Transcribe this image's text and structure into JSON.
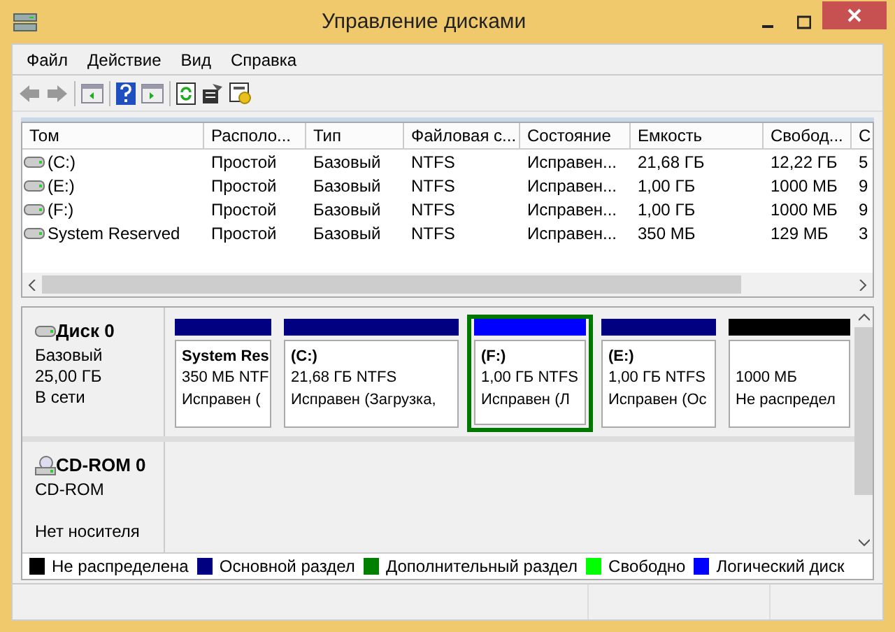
{
  "window": {
    "title": "Управление дисками"
  },
  "menu": [
    "Файл",
    "Действие",
    "Вид",
    "Справка"
  ],
  "table": {
    "columns": [
      "Том",
      "Располо...",
      "Тип",
      "Файловая с...",
      "Состояние",
      "Емкость",
      "Свобод...",
      "С"
    ],
    "rows": [
      [
        "(C:)",
        "Простой",
        "Базовый",
        "NTFS",
        "Исправен...",
        "21,68 ГБ",
        "12,22 ГБ",
        "5"
      ],
      [
        "(E:)",
        "Простой",
        "Базовый",
        "NTFS",
        "Исправен...",
        "1,00 ГБ",
        "1000 МБ",
        "9"
      ],
      [
        "(F:)",
        "Простой",
        "Базовый",
        "NTFS",
        "Исправен...",
        "1,00 ГБ",
        "1000 МБ",
        "9"
      ],
      [
        "System Reserved",
        "Простой",
        "Базовый",
        "NTFS",
        "Исправен...",
        "350 МБ",
        "129 МБ",
        "3"
      ]
    ]
  },
  "disks": [
    {
      "name": "Диск 0",
      "kind": "disk",
      "lines": [
        "Базовый",
        "25,00 ГБ",
        "В сети"
      ],
      "partitions": [
        {
          "name": "System Res",
          "size": "350 МБ NTF",
          "status": "Исправен (",
          "color": "#000080",
          "selected": false
        },
        {
          "name": "(C:)",
          "size": "21,68 ГБ NTFS",
          "status": "Исправен (Загрузка,",
          "color": "#000080",
          "selected": false
        },
        {
          "name": "(F:)",
          "size": "1,00 ГБ NTFS",
          "status": "Исправен (Л",
          "color": "#0000ff",
          "selected": true
        },
        {
          "name": "(E:)",
          "size": "1,00 ГБ NTFS",
          "status": "Исправен (Ос",
          "color": "#000080",
          "selected": false
        },
        {
          "size": "1000 МБ",
          "status": "Не распредел",
          "color": "#000000",
          "selected": false
        }
      ]
    },
    {
      "name": "CD-ROM 0",
      "kind": "cdrom",
      "lines": [
        "CD-ROM",
        "Нет носителя"
      ]
    }
  ],
  "legend": [
    {
      "label": "Не распределена",
      "color": "#000000"
    },
    {
      "label": "Основной раздел",
      "color": "#000080"
    },
    {
      "label": "Дополнительный раздел",
      "color": "#008000"
    },
    {
      "label": "Свободно",
      "color": "#00ff00"
    },
    {
      "label": "Логический диск",
      "color": "#0000ff"
    }
  ]
}
